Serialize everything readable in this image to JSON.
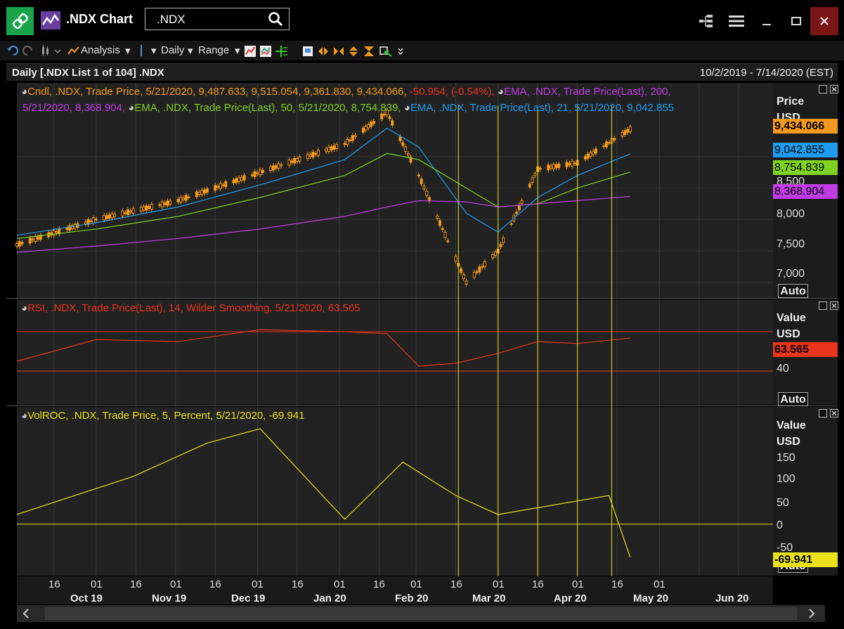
{
  "window": {
    "title": ".NDX Chart",
    "ric_value": ".NDX"
  },
  "toolbar": {
    "analysis": "Analysis",
    "interval": "Daily",
    "range": "Range"
  },
  "header": {
    "left": "Daily [.NDX List 1 of 104] .NDX",
    "right": "10/2/2019 - 7/14/2020 (EST)"
  },
  "price_panel": {
    "legend": {
      "cndl_prefix": "Cndl, .NDX, Trade Price, 5/21/2020, 9,487.633, 9,515.054, 9,361.830, 9,434.066,",
      "cndl_change": "-50.954, (-0.54%),",
      "ema200_line1": "EMA, .NDX, Trade Price(Last),  200,",
      "ema200_line2": "5/21/2020, 8,368.904,",
      "ema50": "EMA, .NDX, Trade Price(Last),  50, 5/21/2020, 8,754.839,",
      "ema21": "EMA, .NDX, Trade Price(Last),  21, 5/21/2020, 9,042.855"
    },
    "axis_title": "Price",
    "axis_unit": "USD",
    "ticks": [
      "8,500",
      "8,000",
      "7,500",
      "7,000"
    ],
    "badges": {
      "close": "9,434.066",
      "ema21": "9,042.855",
      "ema50": "8,754.839",
      "ema200": "8,368.904"
    },
    "auto": "Auto"
  },
  "rsi_panel": {
    "legend": "RSI, .NDX, Trade Price(Last),  14, Wilder Smoothing, 5/21/2020, 63.565",
    "axis_title": "Value",
    "axis_unit": "USD",
    "tick": "40",
    "badge": "63.565",
    "auto": "Auto"
  },
  "volroc_panel": {
    "legend": "VolROC, .NDX, Trade Price,  5, Percent, 5/21/2020, -69.941",
    "axis_title": "Value",
    "axis_unit": "USD",
    "ticks": [
      "150",
      "100",
      "50",
      "0",
      "-50"
    ],
    "badge": "-69.941",
    "auto": "Auto"
  },
  "x_axis": {
    "days": [
      "16",
      "01",
      "16",
      "01",
      "16",
      "01",
      "16",
      "01",
      "16",
      "01",
      "16",
      "01",
      "16",
      "01",
      "16",
      "01"
    ],
    "months": [
      "Oct 19",
      "Nov 19",
      "Dec 19",
      "Jan 20",
      "Feb 20",
      "Mar 20",
      "Apr 20",
      "May 20",
      "Jun 20"
    ]
  },
  "colors": {
    "candle": "#f39a1e",
    "ema21": "#1e9cf0",
    "ema50": "#7ed321",
    "ema200": "#c23ce6",
    "rsi": "#e8351c",
    "volroc": "#e9e21b",
    "marker": "#e9e21b"
  },
  "chart_data": {
    "type": "line",
    "title": "",
    "x": [
      "2019-10-02",
      "2019-11-01",
      "2019-12-02",
      "2020-01-02",
      "2020-02-03",
      "2020-02-19",
      "2020-03-02",
      "2020-03-20",
      "2020-04-01",
      "2020-04-16",
      "2020-05-01",
      "2020-05-21"
    ],
    "series": [
      {
        "name": "Cndl",
        "values": [
          7600,
          8000,
          8300,
          8750,
          9200,
          9700,
          8700,
          7000,
          7500,
          8800,
          8900,
          9434
        ]
      },
      {
        "name": "EMA 21",
        "values": [
          7750,
          7950,
          8200,
          8550,
          8950,
          9450,
          9150,
          8100,
          7800,
          8350,
          8700,
          9042
        ]
      },
      {
        "name": "EMA 50",
        "values": [
          7700,
          7850,
          8050,
          8350,
          8700,
          9050,
          8950,
          8500,
          8200,
          8250,
          8500,
          8754
        ]
      },
      {
        "name": "EMA 200",
        "values": [
          7480,
          7580,
          7700,
          7850,
          8050,
          8200,
          8300,
          8280,
          8200,
          8250,
          8300,
          8368
        ]
      }
    ],
    "ylim": [
      6800,
      9700
    ],
    "x_range": [
      "2019-10-02",
      "2020-07-14"
    ],
    "rsi": {
      "name": "RSI",
      "x": [
        "2019-10-02",
        "2019-11-01",
        "2019-12-02",
        "2020-01-02",
        "2020-02-03",
        "2020-02-19",
        "2020-03-02",
        "2020-03-16",
        "2020-04-01",
        "2020-04-16",
        "2020-05-01",
        "2020-05-21"
      ],
      "values": [
        40,
        62,
        60,
        72,
        70,
        68,
        35,
        38,
        48,
        60,
        58,
        63.565
      ],
      "bands": [
        30,
        70
      ]
    },
    "volroc": {
      "name": "VolROC",
      "x": [
        "2019-10-02",
        "2019-11-15",
        "2019-12-13",
        "2020-01-02",
        "2020-02-03",
        "2020-02-25",
        "2020-03-16",
        "2020-04-01",
        "2020-05-13",
        "2020-05-21"
      ],
      "values": [
        20,
        100,
        170,
        200,
        10,
        130,
        60,
        20,
        60,
        -69.941
      ],
      "ylim": [
        -80,
        200
      ]
    }
  }
}
